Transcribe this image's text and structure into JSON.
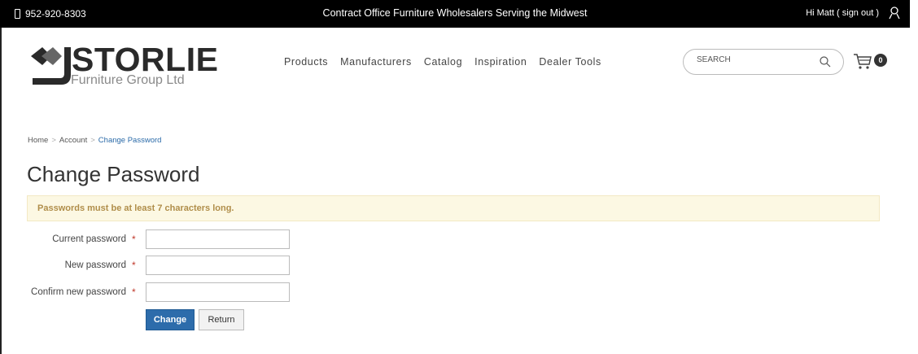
{
  "topbar": {
    "phone": "952-920-8303",
    "tagline": "Contract Office Furniture Wholesalers Serving the Midwest",
    "greeting": "Hi Matt",
    "signout_label": "( sign out )"
  },
  "logo": {
    "brand": "STORLIE",
    "subtitle": "Furniture Group Ltd"
  },
  "nav": {
    "items": [
      {
        "label": "Products"
      },
      {
        "label": "Manufacturers"
      },
      {
        "label": "Catalog"
      },
      {
        "label": "Inspiration"
      },
      {
        "label": "Dealer Tools"
      }
    ]
  },
  "search": {
    "placeholder": "SEARCH"
  },
  "cart": {
    "count": "0"
  },
  "breadcrumb": {
    "items": [
      "Home",
      "Account",
      "Change Password"
    ],
    "separator": ">"
  },
  "page": {
    "title": "Change Password",
    "notice": "Passwords must be at least 7 characters long."
  },
  "form": {
    "required_marker": "*",
    "fields": [
      {
        "label": "Current password",
        "value": ""
      },
      {
        "label": "New password",
        "value": ""
      },
      {
        "label": "Confirm new password",
        "value": ""
      }
    ],
    "change_label": "Change",
    "return_label": "Return"
  },
  "colors": {
    "topbar_bg": "#000000",
    "accent": "#2d6cab",
    "notice_bg": "#fcf8e3",
    "notice_text": "#b08e4a",
    "required": "#c0392b"
  }
}
